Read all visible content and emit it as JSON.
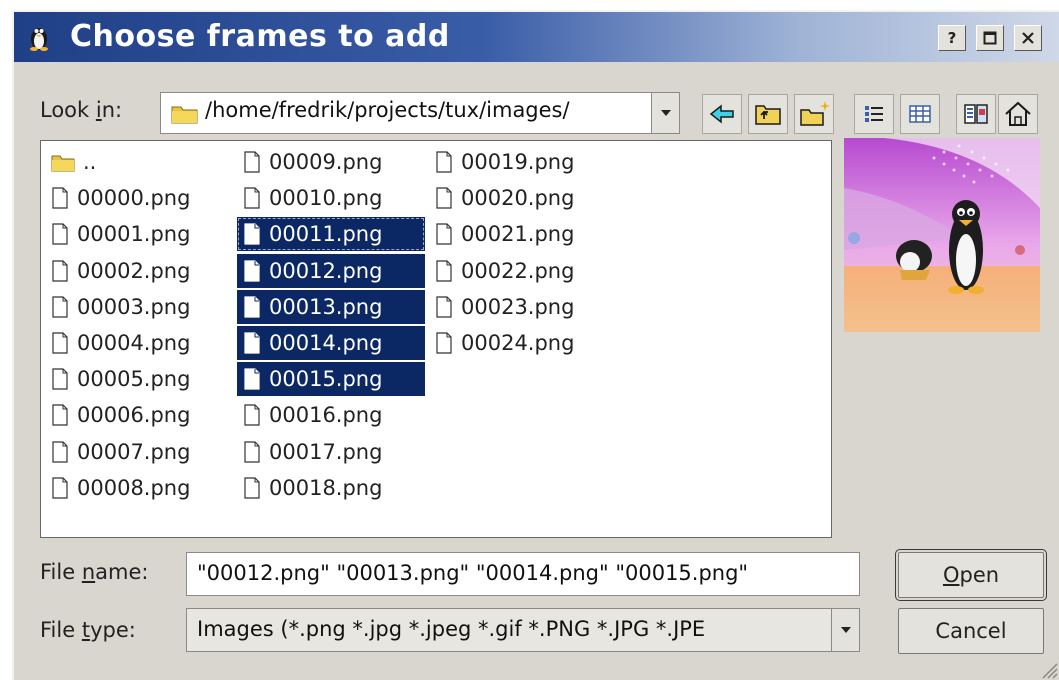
{
  "window": {
    "title": "Choose frames to add",
    "title_icon": "tux-penguin-icon",
    "buttons": {
      "help": "?",
      "maximize": "maximize-icon",
      "close": "close-icon"
    }
  },
  "look_in": {
    "label_pre": "Look ",
    "label_ul": "i",
    "label_post": "n:",
    "path": "/home/fredrik/projects/tux/images/"
  },
  "toolbar": [
    "back-icon",
    "parent-directory-icon",
    "new-folder-icon",
    "list-view-icon",
    "detail-view-icon",
    "preview-icon",
    "home-icon"
  ],
  "files": {
    "columns": [
      [
        {
          "name": "..",
          "type": "folder"
        },
        {
          "name": "00000.png"
        },
        {
          "name": "00001.png"
        },
        {
          "name": "00002.png"
        },
        {
          "name": "00003.png"
        },
        {
          "name": "00004.png"
        },
        {
          "name": "00005.png"
        },
        {
          "name": "00006.png"
        },
        {
          "name": "00007.png"
        },
        {
          "name": "00008.png"
        }
      ],
      [
        {
          "name": "00009.png"
        },
        {
          "name": "00010.png"
        },
        {
          "name": "00011.png",
          "selected": true,
          "focused": true
        },
        {
          "name": "00012.png",
          "selected": true
        },
        {
          "name": "00013.png",
          "selected": true
        },
        {
          "name": "00014.png",
          "selected": true
        },
        {
          "name": "00015.png",
          "selected": true
        },
        {
          "name": "00016.png"
        },
        {
          "name": "00017.png"
        },
        {
          "name": "00018.png"
        }
      ],
      [
        {
          "name": "00019.png"
        },
        {
          "name": "00020.png"
        },
        {
          "name": "00021.png"
        },
        {
          "name": "00022.png"
        },
        {
          "name": "00023.png"
        },
        {
          "name": "00024.png"
        }
      ]
    ]
  },
  "file_name": {
    "label_pre": "File ",
    "label_ul": "n",
    "label_post": "ame:",
    "value": "\"00012.png\" \"00013.png\" \"00014.png\" \"00015.png\""
  },
  "file_type": {
    "label_pre": "File ",
    "label_ul": "t",
    "label_post": "ype:",
    "value": "Images (*.png *.jpg *.jpeg  *.gif *.PNG *.JPG *.JPE"
  },
  "buttons": {
    "open_ul": "O",
    "open_rest": "pen",
    "cancel": "Cancel"
  },
  "colors": {
    "selection": "#0b2764",
    "titlebar_start": "#1f3f86",
    "dialog_bg": "#d9d6cf"
  }
}
